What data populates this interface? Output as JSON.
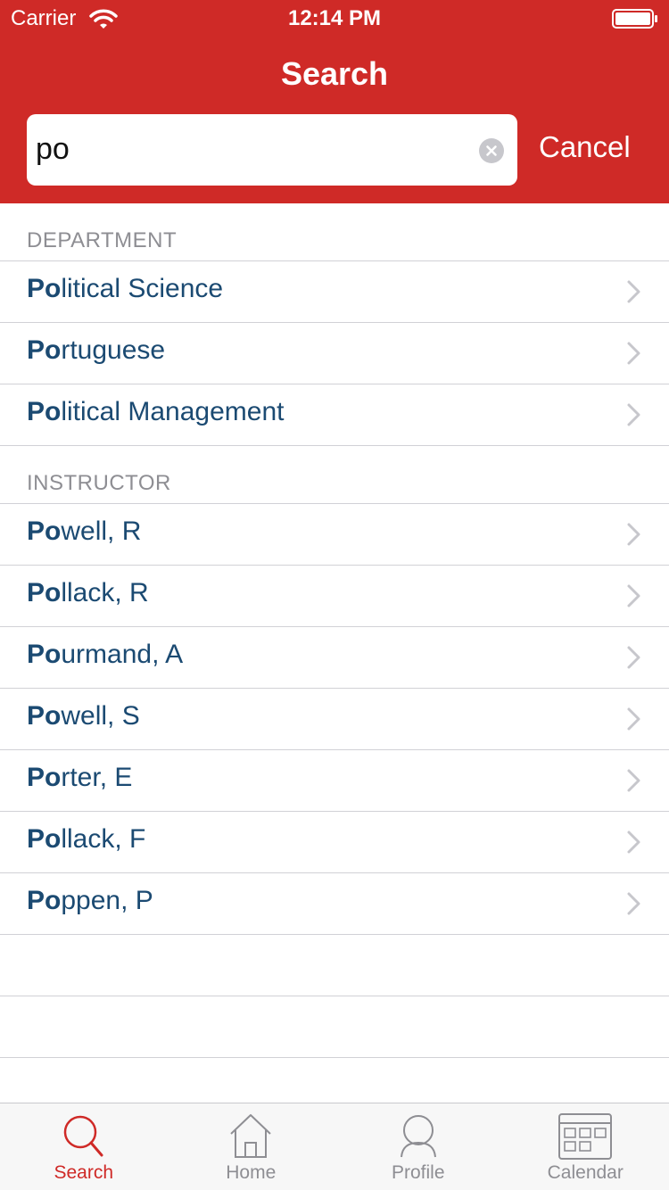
{
  "status_bar": {
    "carrier": "Carrier",
    "time": "12:14 PM"
  },
  "nav": {
    "title": "Search"
  },
  "search": {
    "value": "po",
    "cancel_label": "Cancel"
  },
  "sections": [
    {
      "title": "DEPARTMENT",
      "rows": [
        {
          "match": "Po",
          "rest": "litical Science"
        },
        {
          "match": "Po",
          "rest": "rtuguese"
        },
        {
          "match": "Po",
          "rest": "litical Management"
        }
      ]
    },
    {
      "title": "INSTRUCTOR",
      "rows": [
        {
          "match": "Po",
          "rest": "well, R"
        },
        {
          "match": "Po",
          "rest": "llack, R"
        },
        {
          "match": "Po",
          "rest": "urmand, A"
        },
        {
          "match": "Po",
          "rest": "well, S"
        },
        {
          "match": "Po",
          "rest": "rter, E"
        },
        {
          "match": "Po",
          "rest": "llack, F"
        },
        {
          "match": "Po",
          "rest": "ppen, P"
        }
      ]
    }
  ],
  "tabbar": [
    {
      "label": "Search",
      "icon": "search-icon",
      "active": true
    },
    {
      "label": "Home",
      "icon": "home-icon",
      "active": false
    },
    {
      "label": "Profile",
      "icon": "profile-icon",
      "active": false
    },
    {
      "label": "Calendar",
      "icon": "calendar-icon",
      "active": false
    }
  ],
  "colors": {
    "brand": "#cf2a27",
    "link": "#1b4a72",
    "muted": "#8e8e93"
  }
}
